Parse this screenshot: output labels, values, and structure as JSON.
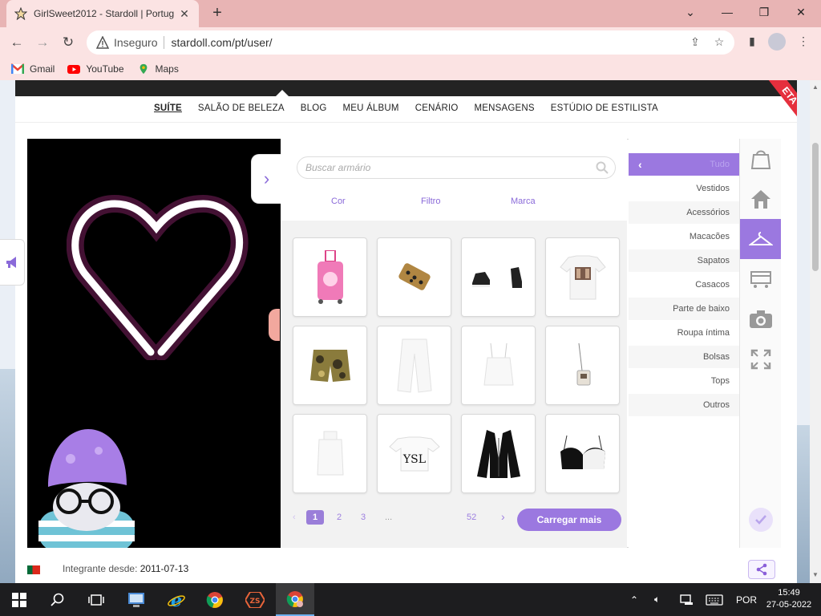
{
  "browser": {
    "tab_title": "GirlSweet2012 - Stardoll | Portug",
    "security_label": "Inseguro",
    "url": "stardoll.com/pt/user/",
    "bookmarks": [
      {
        "label": "Gmail"
      },
      {
        "label": "YouTube"
      },
      {
        "label": "Maps"
      }
    ]
  },
  "site": {
    "subnav": [
      "SUÍTE",
      "SALÃO DE BELEZA",
      "BLOG",
      "MEU ÁLBUM",
      "CENÁRIO",
      "MENSAGENS",
      "ESTÚDIO DE ESTILISTA"
    ],
    "beta_label": "ETA"
  },
  "closet": {
    "search_placeholder": "Buscar armário",
    "filters": [
      "Cor",
      "Filtro",
      "Marca"
    ],
    "pagination": {
      "pages": [
        "1",
        "2",
        "3",
        "..."
      ],
      "last": "52",
      "current": "1"
    },
    "load_more": "Carregar mais"
  },
  "categories": [
    "Tudo",
    "Vestidos",
    "Acessórios",
    "Macacões",
    "Sapatos",
    "Casacos",
    "Parte de baixo",
    "Roupa íntima",
    "Bolsas",
    "Tops",
    "Outros"
  ],
  "footer": {
    "member_label": "Integrante desde:",
    "member_since": "2011-07-13"
  },
  "taskbar": {
    "language": "POR",
    "time": "15:49",
    "date": "27-05-2022"
  },
  "colors": {
    "accent": "#9b78e0",
    "browser_frame": "#e8b4b4",
    "browser_toolbar": "#fbe3e3",
    "beta_band": "#e52f3d"
  }
}
